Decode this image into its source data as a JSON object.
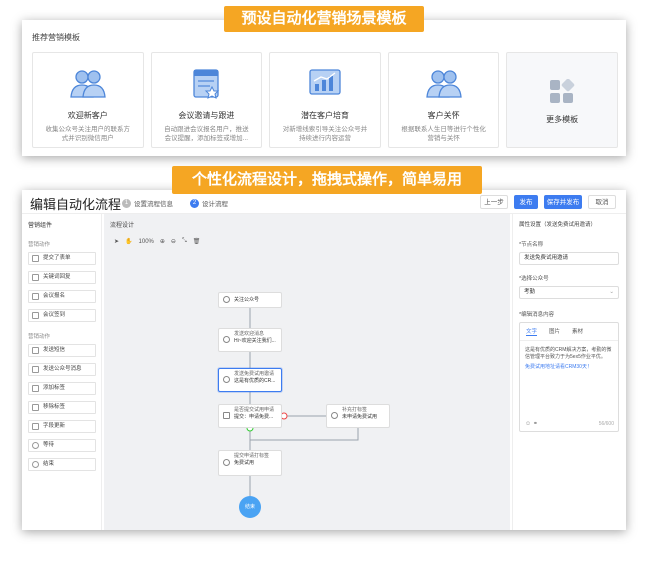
{
  "banners": {
    "top": "预设自动化营销场景模板",
    "middle": "个性化流程设计，拖拽式操作，简单易用"
  },
  "templates": {
    "title": "推荐营销模板",
    "cards": [
      {
        "title": "欢迎新客户",
        "desc1": "收集公众号关注用户的联系方",
        "desc2": "式并识别微信用户",
        "icon": "users-icon"
      },
      {
        "title": "会议邀请与跟进",
        "desc1": "自动跟进会议报名用户，推送",
        "desc2": "会议提醒，添加标签或增加...",
        "icon": "calendar-icon"
      },
      {
        "title": "潜在客户培育",
        "desc1": "对新增线索引导关注公众号并",
        "desc2": "持续进行内容运营",
        "icon": "chart-icon"
      },
      {
        "title": "客户关怀",
        "desc1": "根据联系人生日等进行个性化",
        "desc2": "营销与关怀",
        "icon": "users-icon"
      },
      {
        "title": "更多模板",
        "icon": "grid-icon"
      }
    ]
  },
  "editor": {
    "title": "编辑自动化流程",
    "steps": [
      {
        "num": "1",
        "label": "设置流程信息"
      },
      {
        "num": "2",
        "label": "设计流程"
      }
    ],
    "buttons": {
      "prev": "上一步",
      "publish": "发布",
      "save_publish": "保存并发布",
      "cancel": "取消"
    }
  },
  "components": {
    "title": "营销组件",
    "section1": "营销动作",
    "items1": [
      "提交了表单",
      "关键词回复",
      "会议报名",
      "会议签到"
    ],
    "section2": "营销动作",
    "items2": [
      "发送短信",
      "发送公众号消息",
      "添加标签",
      "移除标签",
      "字段更新",
      "等待",
      "结束"
    ]
  },
  "canvas": {
    "title": "流程设计",
    "zoom": "100%",
    "nodes": {
      "n1": "关注公众号",
      "n2a": "发送欢迎消息",
      "n2b": "Hi~欢迎关注我们...",
      "n3a": "发送免费试用邀请",
      "n3b": "这是有优质的CR...",
      "n4a": "是否提交试用申请",
      "n4b": "提交：申请免费...",
      "n5a": "补充打标签",
      "n5b": "未申请免费试用",
      "n6a": "提交申请打标签",
      "n6b": "免费试用",
      "end": "结束"
    }
  },
  "properties": {
    "title": "属性设置（发送免费试用邀请）",
    "name_label": "*节点名称",
    "name_value": "发送免费试用邀请",
    "account_label": "*选择公众号",
    "account_value": "考勤",
    "content_label": "*编辑消息内容",
    "tabs": [
      "文字",
      "图片",
      "素材"
    ],
    "text": "这是有优质的CRM解决方案，考勤的微信管理平台致力于为5ex5作业平优。",
    "link": "免费试用地址请看CRM30天！",
    "counter": "56/600"
  }
}
